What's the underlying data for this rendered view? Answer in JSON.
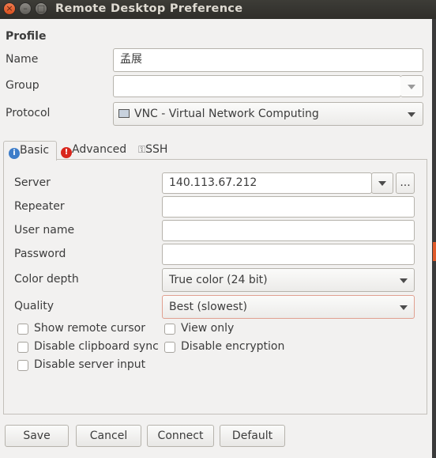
{
  "window": {
    "title": "Remote Desktop Preference"
  },
  "profile": {
    "section_title": "Profile",
    "name_label": "Name",
    "name_value": "孟展",
    "group_label": "Group",
    "group_value": "",
    "protocol_label": "Protocol",
    "protocol_value": "VNC - Virtual Network Computing"
  },
  "tabs": [
    {
      "label": "Basic",
      "icon": "info-icon",
      "active": true
    },
    {
      "label": "Advanced",
      "icon": "warning-icon",
      "active": false
    },
    {
      "label": "SSH",
      "icon": "key-icon",
      "active": false
    }
  ],
  "basic": {
    "server_label": "Server",
    "server_value": "140.113.67.212",
    "browse_label": "...",
    "repeater_label": "Repeater",
    "repeater_value": "",
    "username_label": "User name",
    "username_value": "",
    "password_label": "Password",
    "password_value": "",
    "color_depth_label": "Color depth",
    "color_depth_value": "True color (24 bit)",
    "quality_label": "Quality",
    "quality_value": "Best (slowest)",
    "checkboxes": {
      "show_remote_cursor": "Show remote cursor",
      "view_only": "View only",
      "disable_clipboard_sync": "Disable clipboard sync",
      "disable_encryption": "Disable encryption",
      "disable_server_input": "Disable server input"
    }
  },
  "buttons": {
    "save": "Save",
    "cancel": "Cancel",
    "connect": "Connect",
    "default": "Default"
  },
  "colors": {
    "titlebar": "#3d3c37",
    "close_button": "#f07a4f",
    "quality_border": "#e0a090"
  }
}
